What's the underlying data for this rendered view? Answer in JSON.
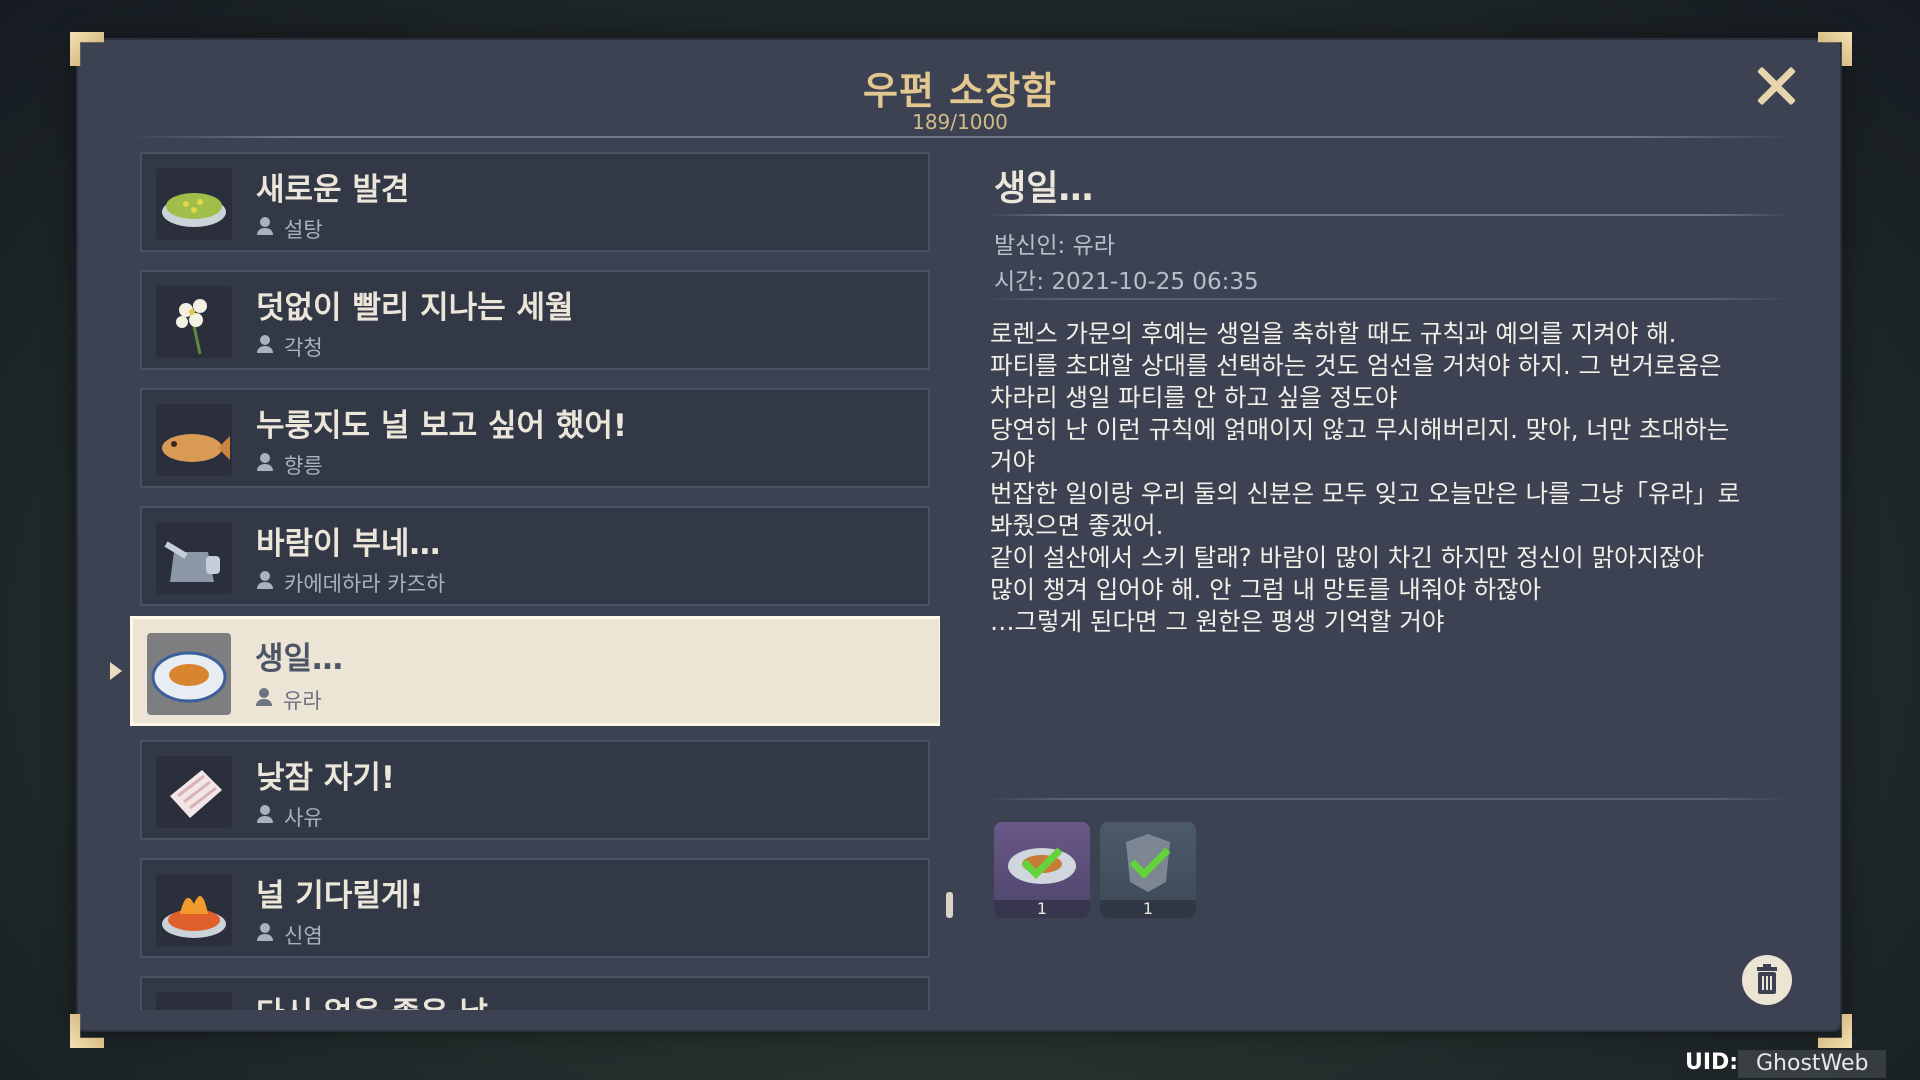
{
  "header": {
    "title": "우편 소장함",
    "count": "189/1000"
  },
  "mails": [
    {
      "title": "새로운 발견",
      "sender": "설탕",
      "icon": "dish-icon"
    },
    {
      "title": "덧없이 빨리 지나는 세월",
      "sender": "각청",
      "icon": "flower-icon"
    },
    {
      "title": "누룽지도 널 보고 싶어 했어!",
      "sender": "향릉",
      "icon": "fish-icon"
    },
    {
      "title": "바람이 부네…",
      "sender": "카에데하라 카즈하",
      "icon": "teapot-icon"
    },
    {
      "title": "생일…",
      "sender": "유라",
      "icon": "plate-icon"
    },
    {
      "title": "낮잠 자기!",
      "sender": "사유",
      "icon": "meat-icon"
    },
    {
      "title": "널 기다릴게!",
      "sender": "신염",
      "icon": "fire-dish-icon"
    },
    {
      "title": "다시 없을 좋은 날",
      "sender": "",
      "icon": "crab-icon"
    }
  ],
  "detail": {
    "title": "생일…",
    "sender_line": "발신인: 유라",
    "time_line": "시간: 2021-10-25 06:35",
    "body": "로렌스 가문의 후예는 생일을 축하할 때도 규칙과 예의를 지켜야 해.\n파티를 초대할 상대를 선택하는 것도 엄선을 거쳐야 하지. 그 번거로움은\n차라리 생일 파티를 안 하고 싶을 정도야\n당연히 난 이런 규칙에 얽매이지 않고 무시해버리지. 맞아, 너만 초대하는\n거야\n번잡한 일이랑 우리 둘의 신분은 모두 잊고 오늘만은 나를 그냥「유라」로\n봐줬으면 좋겠어.\n같이 설산에서 스키 탈래? 바람이 많이 차긴 하지만 정신이 맑아지잖아\n많이 챙겨 입어야 해. 안 그럼 내 망토를 내줘야 하잖아\n…그렇게 된다면 그 원한은 평생 기억할 거야",
    "attachments": [
      {
        "qty": "1",
        "icon": "dish-attachment-icon",
        "claimed": true
      },
      {
        "qty": "1",
        "icon": "armor-attachment-icon",
        "claimed": true
      }
    ]
  },
  "footer": {
    "uid_label": "UID:",
    "uid_value": "GhostWeb"
  },
  "colors": {
    "panel": "#3c4252",
    "gold": "#e2c890",
    "selected": "#ece4d4",
    "check": "#63d33b"
  }
}
